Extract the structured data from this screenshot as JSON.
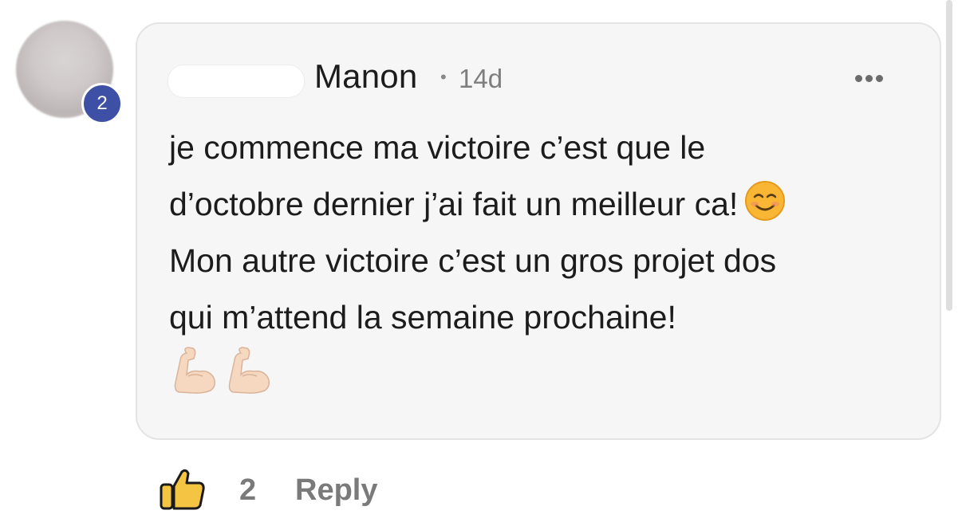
{
  "comment": {
    "avatar_badge": "2",
    "author": "Manon",
    "separator": "•",
    "time": "14d",
    "more_icon": "more-horizontal-icon",
    "lines": [
      "je commence ma victoire c’est que le",
      "d’octobre dernier j’ai fait un meilleur ca!",
      "Mon autre victoire c’est un gros projet dos",
      "qui m’attend la semaine prochaine!"
    ],
    "emojis": [
      "smiling-face-icon",
      "flexed-biceps-icon",
      "flexed-biceps-icon"
    ]
  },
  "actions": {
    "like_icon": "thumbs-up-icon",
    "like_count": "2",
    "reply_label": "Reply"
  },
  "colors": {
    "badge": "#3e4fa6",
    "bubble_bg": "#f6f6f6",
    "action_text": "#7a7a7a"
  }
}
